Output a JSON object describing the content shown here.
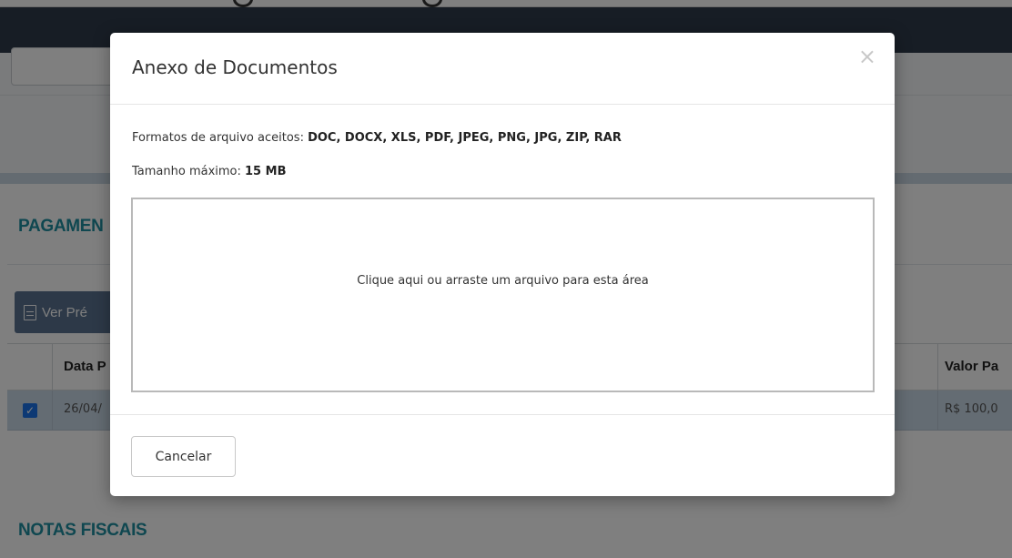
{
  "background": {
    "section_payments_title": "PAGAMEN",
    "section_invoices_title": "NOTAS FISCAIS",
    "preview_button_label": "Ver Pré",
    "table": {
      "headers": [
        "Data P",
        "Valor Pa"
      ],
      "row": {
        "checked": true,
        "date": "26/04/",
        "value": "R$ 100,0"
      }
    }
  },
  "modal": {
    "title": "Anexo de Documentos",
    "close_symbol": "×",
    "formats_label": "Formatos de arquivo aceitos: ",
    "formats_value": "DOC, DOCX, XLS, PDF, JPEG, PNG, JPG, ZIP, RAR",
    "size_label": "Tamanho máximo: ",
    "size_value": "15 MB",
    "dropzone_text": "Clique aqui ou arraste um arquivo para esta área",
    "cancel_label": "Cancelar"
  },
  "colors": {
    "navbar": "#2f3a4b",
    "section_title": "#1e8fa0",
    "preview_button": "#5a7390",
    "selected_row": "#c9d8e6",
    "checkbox": "#1a73e8"
  }
}
